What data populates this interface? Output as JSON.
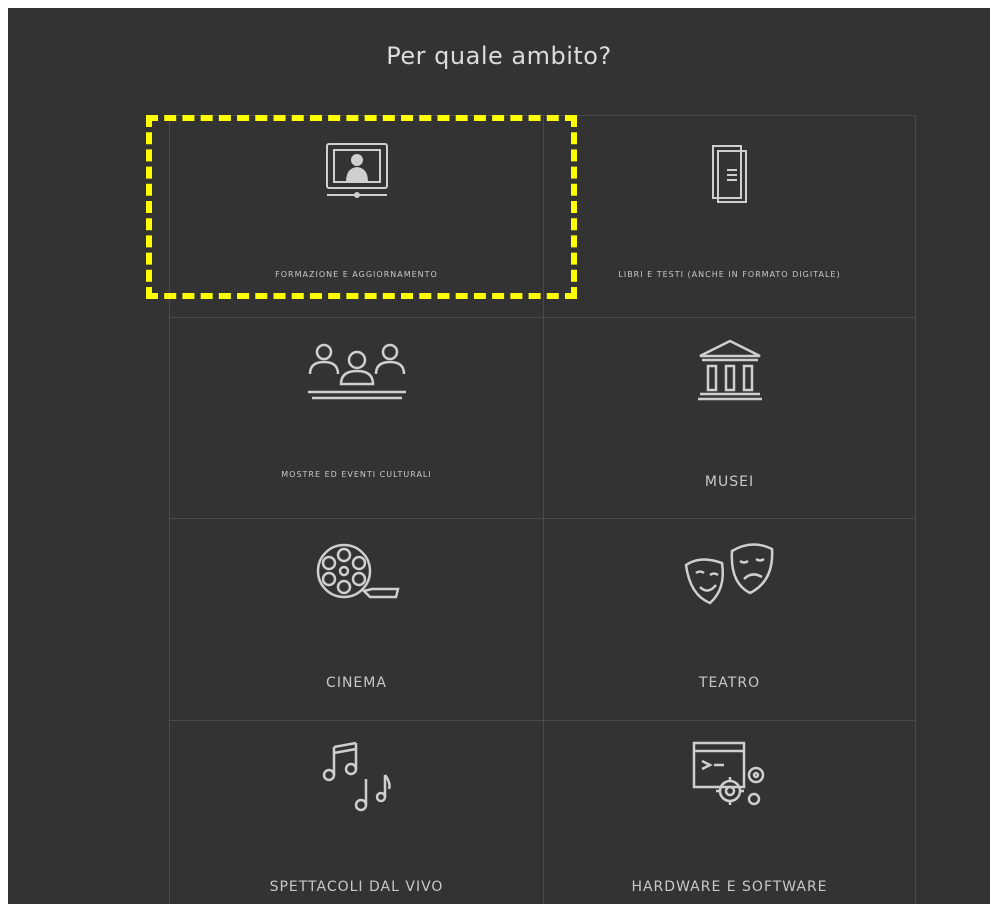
{
  "heading": "Per quale ambito?",
  "highlight_color": "#ffff00",
  "cards": [
    {
      "id": "formazione",
      "label": "FORMAZIONE E AGGIORNAMENTO",
      "icon": "video-lesson-icon"
    },
    {
      "id": "libri",
      "label": "LIBRI E TESTI (ANCHE IN FORMATO DIGITALE)",
      "icon": "book-icon"
    },
    {
      "id": "mostre",
      "label": "MOSTRE ED EVENTI CULTURALI",
      "icon": "audience-icon"
    },
    {
      "id": "musei",
      "label": "MUSEI",
      "icon": "museum-icon"
    },
    {
      "id": "cinema",
      "label": "CINEMA",
      "icon": "film-reel-icon"
    },
    {
      "id": "teatro",
      "label": "TEATRO",
      "icon": "theater-masks-icon"
    },
    {
      "id": "spettacoli",
      "label": "SPETTACOLI DAL VIVO",
      "icon": "music-notes-icon"
    },
    {
      "id": "hardware",
      "label": "HARDWARE E SOFTWARE",
      "icon": "software-gears-icon"
    }
  ]
}
